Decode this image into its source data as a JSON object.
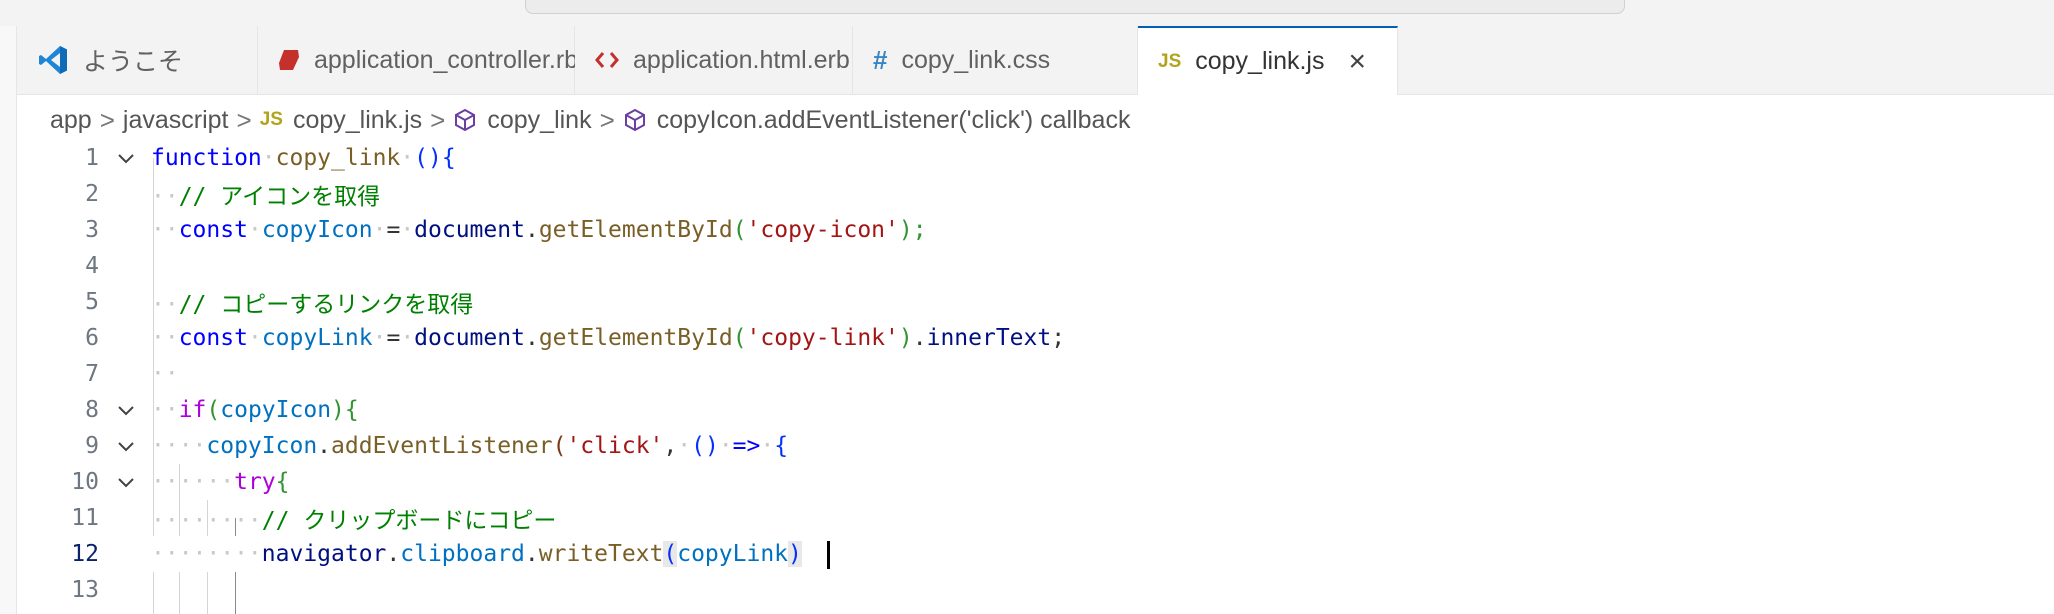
{
  "tabs": [
    {
      "label": "ようこそ",
      "icon": "vscode-logo-icon"
    },
    {
      "label": "application_controller.rb",
      "icon": "ruby-icon"
    },
    {
      "label": "application.html.erb",
      "icon": "code-brackets-icon"
    },
    {
      "label": "copy_link.css",
      "icon": "hash-icon",
      "icon_text": "#"
    },
    {
      "label": "copy_link.js",
      "icon": "js-icon",
      "icon_text": "JS",
      "active": true,
      "close": "×"
    }
  ],
  "breadcrumb": {
    "app": "app",
    "folder": "javascript",
    "file": "copy_link.js",
    "file_icon_text": "JS",
    "symbol": "copy_link",
    "callback": "copyIcon.addEventListener('click') callback",
    "separator": ">"
  },
  "editor": {
    "current_line": 12,
    "line_numbers": [
      "1",
      "2",
      "3",
      "4",
      "5",
      "6",
      "7",
      "8",
      "9",
      "10",
      "11",
      "12",
      "13"
    ],
    "lines": [
      "function copy_link (){",
      "  // アイコンを取得",
      "  const copyIcon = document.getElementById('copy-icon');",
      "",
      "  // コピーするリンクを取得",
      "  const copyLink = document.getElementById('copy-link').innerText;",
      "  ",
      "  if(copyIcon){",
      "    copyIcon.addEventListener('click', () => {",
      "      try{",
      "        // クリップボードにコピー",
      "        navigator.clipboard.writeText(copyLink)",
      ""
    ],
    "tokens": {
      "l1": {
        "kw": "function",
        "name": "copy_link",
        "paren": "(){"
      },
      "l2": {
        "comment": "// アイコンを取得"
      },
      "l3": {
        "const": "const",
        "var": "copyIcon",
        "eq": "=",
        "obj": "document",
        "dot": ".",
        "method": "getElementById",
        "open": "(",
        "str": "'copy-icon'",
        "close": ");"
      },
      "l5": {
        "comment": "// コピーするリンクを取得"
      },
      "l6": {
        "const": "const",
        "var": "copyLink",
        "eq": "=",
        "obj": "document",
        "dot": ".",
        "method": "getElementById",
        "open": "(",
        "str": "'copy-link'",
        "close": ")",
        "dot2": ".",
        "prop": "innerText",
        "semi": ";"
      },
      "l8": {
        "kw": "if",
        "open": "(",
        "var": "copyIcon",
        "close": ")",
        "brace": "{"
      },
      "l9": {
        "var": "copyIcon",
        "dot": ".",
        "method": "addEventListener",
        "open": "(",
        "str": "'click'",
        "comma": ",",
        "arrowp": "()",
        "arrow": "=>",
        "brace": "{"
      },
      "l10": {
        "kw": "try",
        "brace": "{"
      },
      "l11": {
        "comment": "// クリップボードにコピー"
      },
      "l12": {
        "obj": "navigator",
        "dot": ".",
        "prop": "clipboard",
        "dot2": ".",
        "method": "writeText",
        "open": "(",
        "var": "copyLink",
        "close": ")"
      }
    }
  },
  "colors": {
    "keyword": "#0000ff",
    "control": "#af00db",
    "function": "#795e26",
    "variable": "#001080",
    "constant": "#0070c1",
    "string": "#a31515",
    "comment": "#008000",
    "active_tab_border": "#005fb8"
  }
}
